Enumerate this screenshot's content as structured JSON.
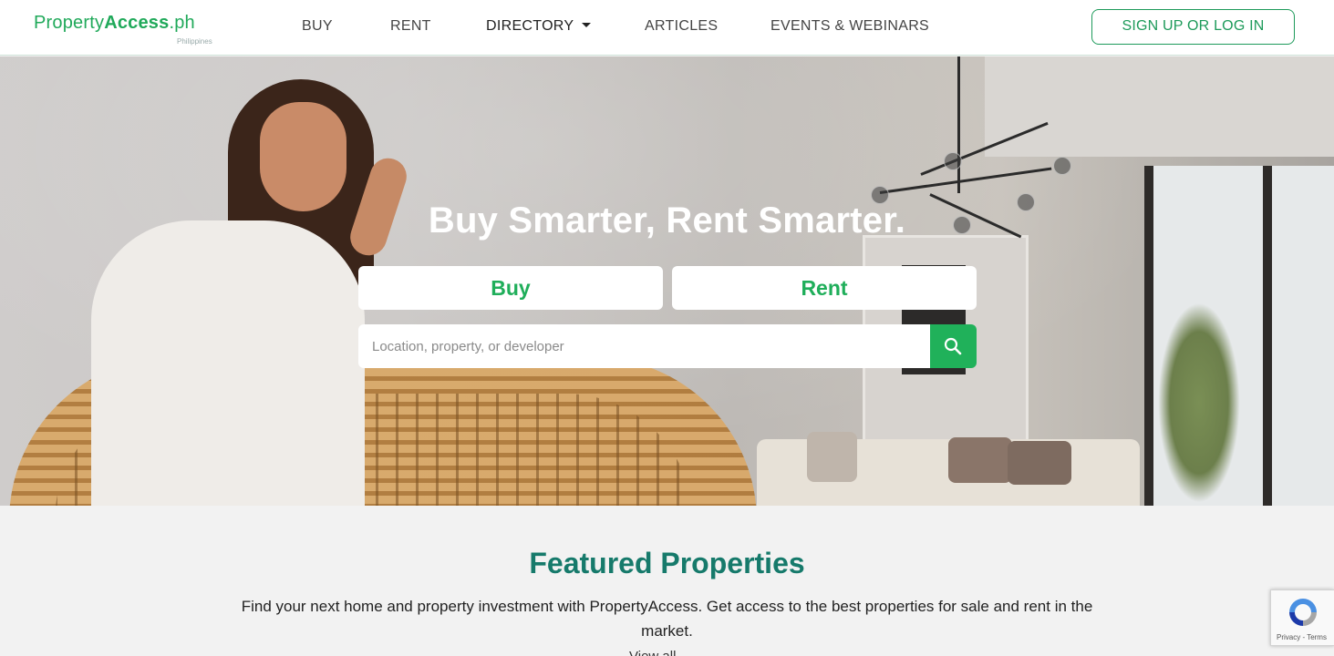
{
  "header": {
    "logo_prefix": "Property",
    "logo_bold": "Access",
    "logo_suffix": ".ph",
    "logo_subtitle": "Philippines",
    "nav": {
      "buy": "BUY",
      "rent": "RENT",
      "directory": "DIRECTORY",
      "articles": "ARTICLES",
      "events": "EVENTS & WEBINARS"
    },
    "signup_label": "SIGN UP OR LOG IN"
  },
  "hero": {
    "title": "Buy Smarter, Rent Smarter.",
    "buy_tab": "Buy",
    "rent_tab": "Rent",
    "search_placeholder": "Location, property, or developer",
    "search_icon": "search-icon"
  },
  "featured": {
    "title": "Featured Properties",
    "description": "Find your next home and property investment with PropertyAccess. Get access to the best properties for sale and rent in the market.",
    "more": "View all"
  },
  "recaptcha": {
    "text": "Privacy - Terms"
  },
  "colors": {
    "brand_green": "#20a95a",
    "heading_teal": "#167a6b"
  }
}
